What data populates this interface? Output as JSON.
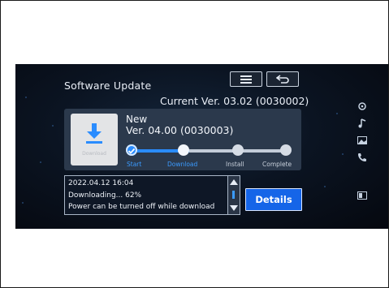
{
  "screen": {
    "title": "Software Update",
    "current_version": "Current Ver. 03.02 (0030002)",
    "new_label": "New",
    "new_version": "Ver. 04.00 (0030003)",
    "tile_label": "Download",
    "progress_fraction": 0.38,
    "steps": [
      {
        "label": "Start",
        "state": "done"
      },
      {
        "label": "Download",
        "state": "active"
      },
      {
        "label": "Install",
        "state": "pending"
      },
      {
        "label": "Complete",
        "state": "pending"
      }
    ],
    "status": {
      "timestamp": "2022.04.12 16:04",
      "progress_text": "Downloading... 62%",
      "note": "Power can be turned off while download"
    },
    "details_label": "Details",
    "icons": {
      "menu": "menu-icon",
      "back": "back-icon",
      "scroll_up": "arrow-up-icon",
      "scroll_down": "arrow-down-icon",
      "side": [
        "radio-icon",
        "music-note-icon",
        "image-icon",
        "phone-icon",
        "screen-toggle-icon"
      ]
    },
    "colors": {
      "accent": "#2a8cff",
      "panel": "#2b394c",
      "button": "#1565e8"
    }
  }
}
